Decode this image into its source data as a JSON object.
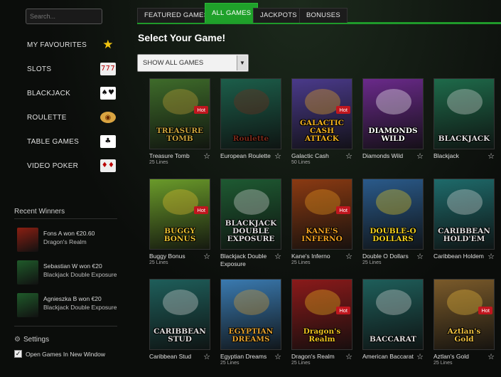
{
  "search": {
    "placeholder": "Search..."
  },
  "nav": [
    {
      "label": "MY FAVOURITES",
      "icon": "star-icon"
    },
    {
      "label": "SLOTS",
      "icon": "slot-machine-icon",
      "glyph": "777"
    },
    {
      "label": "BLACKJACK",
      "icon": "playing-cards-icon",
      "glyph": "♠♥"
    },
    {
      "label": "ROULETTE",
      "icon": "roulette-wheel-icon",
      "glyph": "◉"
    },
    {
      "label": "TABLE GAMES",
      "icon": "card-table-icon",
      "glyph": "♣"
    },
    {
      "label": "VIDEO POKER",
      "icon": "poker-cards-icon",
      "glyph": "♦♦"
    }
  ],
  "recent_winners": {
    "title": "Recent Winners",
    "items": [
      {
        "line1": "Fons A won €20.60",
        "line2": "Dragon's Realm",
        "color": "#8b1f12"
      },
      {
        "line1": "Sebastian W won €20",
        "line2": "Blackjack Double Exposure",
        "color": "#1f5a2a"
      },
      {
        "line1": "Agnieszka B won €20",
        "line2": "Blackjack Double Exposure",
        "color": "#1f5a2a"
      }
    ]
  },
  "settings": {
    "title": "Settings",
    "open_new_window": "Open Games In New Window",
    "checked": true
  },
  "tabs": [
    {
      "label": "FEATURED GAMES",
      "active": false
    },
    {
      "label": "ALL GAMES",
      "active": true
    },
    {
      "label": "JACKPOTS",
      "active": false
    },
    {
      "label": "BONUSES",
      "active": false
    }
  ],
  "main": {
    "title": "Select Your Game!",
    "filter": "SHOW ALL GAMES"
  },
  "hot_label": "Hot",
  "games": [
    {
      "name": "Treasure Tomb",
      "lines": "25 Lines",
      "logo": "TREASURE TOMB",
      "hot": true,
      "bg": "#3e6b2a",
      "accent": "#c8a23a"
    },
    {
      "name": "European Roulette",
      "lines": "",
      "logo": "Roulette",
      "hot": false,
      "bg": "#1c5e4a",
      "accent": "#7a2a1a"
    },
    {
      "name": "Galactic Cash",
      "lines": "50 Lines",
      "logo": "GALACTIC CASH ATTACK",
      "hot": true,
      "bg": "#4a3a8a",
      "accent": "#f0b020"
    },
    {
      "name": "Diamonds Wild",
      "lines": "",
      "logo": "DIAMONDS WILD",
      "hot": false,
      "bg": "#6a2a8a",
      "accent": "#ffffff"
    },
    {
      "name": "Blackjack",
      "lines": "",
      "logo": "BLACKJACK",
      "hot": false,
      "bg": "#1e6a4a",
      "accent": "#dddddd"
    },
    {
      "name": "Buggy Bonus",
      "lines": "25 Lines",
      "logo": "BUGGY BONUS",
      "hot": true,
      "bg": "#6a9a2a",
      "accent": "#e8c030"
    },
    {
      "name": "Blackjack Double Exposure",
      "lines": "",
      "logo": "BLACKJACK DOUBLE EXPOSURE",
      "hot": false,
      "bg": "#1e5a32",
      "accent": "#dddddd"
    },
    {
      "name": "Kane's Inferno",
      "lines": "25 Lines",
      "logo": "KANE'S INFERNO",
      "hot": true,
      "bg": "#8a3a12",
      "accent": "#f0a020"
    },
    {
      "name": "Double O Dollars",
      "lines": "25 Lines",
      "logo": "DOUBLE-O DOLLARS",
      "hot": false,
      "bg": "#2a5a8a",
      "accent": "#f0d020"
    },
    {
      "name": "Caribbean Holdem",
      "lines": "",
      "logo": "CARIBBEAN HOLD'EM",
      "hot": false,
      "bg": "#1e6a6a",
      "accent": "#dddddd"
    },
    {
      "name": "Caribbean Stud",
      "lines": "",
      "logo": "CARIBBEAN STUD",
      "hot": false,
      "bg": "#1e5e5a",
      "accent": "#dddddd"
    },
    {
      "name": "Egyptian Dreams",
      "lines": "25 Lines",
      "logo": "EGYPTIAN DREAMS",
      "hot": false,
      "bg": "#3a7ab0",
      "accent": "#e0a030"
    },
    {
      "name": "Dragon's Realm",
      "lines": "25 Lines",
      "logo": "Dragon's Realm",
      "hot": true,
      "bg": "#8a1a1a",
      "accent": "#f0c020"
    },
    {
      "name": "American Baccarat",
      "lines": "",
      "logo": "BACCARAT",
      "hot": false,
      "bg": "#1e5e5a",
      "accent": "#dddddd"
    },
    {
      "name": "Aztlan's Gold",
      "lines": "25 Lines",
      "logo": "Aztlan's Gold",
      "hot": true,
      "bg": "#7a5a2a",
      "accent": "#f0c040"
    }
  ]
}
